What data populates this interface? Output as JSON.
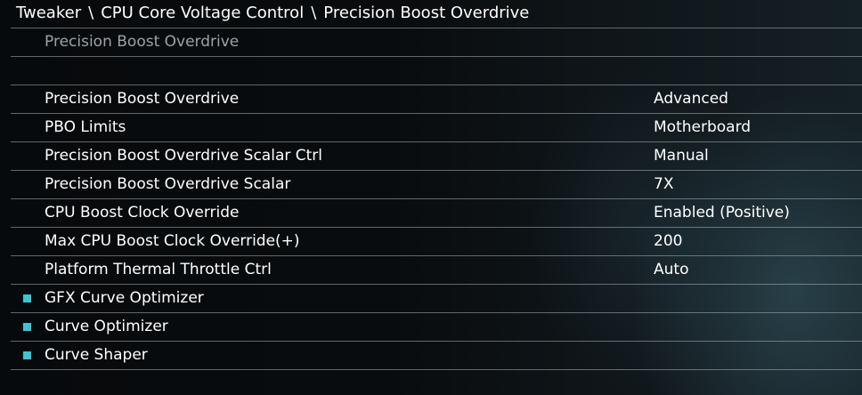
{
  "breadcrumb": {
    "items": [
      "Tweaker",
      "CPU Core Voltage Control",
      "Precision Boost Overdrive"
    ],
    "separator": "\\"
  },
  "help_text": "Precision Boost Overdrive",
  "settings": [
    {
      "label": "Precision Boost Overdrive",
      "value": "Advanced"
    },
    {
      "label": "PBO Limits",
      "value": "Motherboard"
    },
    {
      "label": "Precision Boost Overdrive Scalar Ctrl",
      "value": "Manual"
    },
    {
      "label": "Precision Boost Overdrive Scalar",
      "value": "7X"
    },
    {
      "label": "CPU Boost Clock Override",
      "value": "Enabled (Positive)"
    },
    {
      "label": "Max CPU Boost Clock Override(+)",
      "value": "200"
    },
    {
      "label": "Platform Thermal Throttle Ctrl",
      "value": "Auto"
    }
  ],
  "submenus": [
    {
      "label": "GFX Curve Optimizer",
      "icon": "square-bullet-icon"
    },
    {
      "label": "Curve Optimizer",
      "icon": "square-bullet-icon"
    },
    {
      "label": "Curve Shaper",
      "icon": "square-bullet-icon"
    }
  ],
  "colors": {
    "accent": "#39c6d2",
    "text": "#ffffff",
    "help_text": "#9aa3a8",
    "divider": "#aab4ba"
  }
}
